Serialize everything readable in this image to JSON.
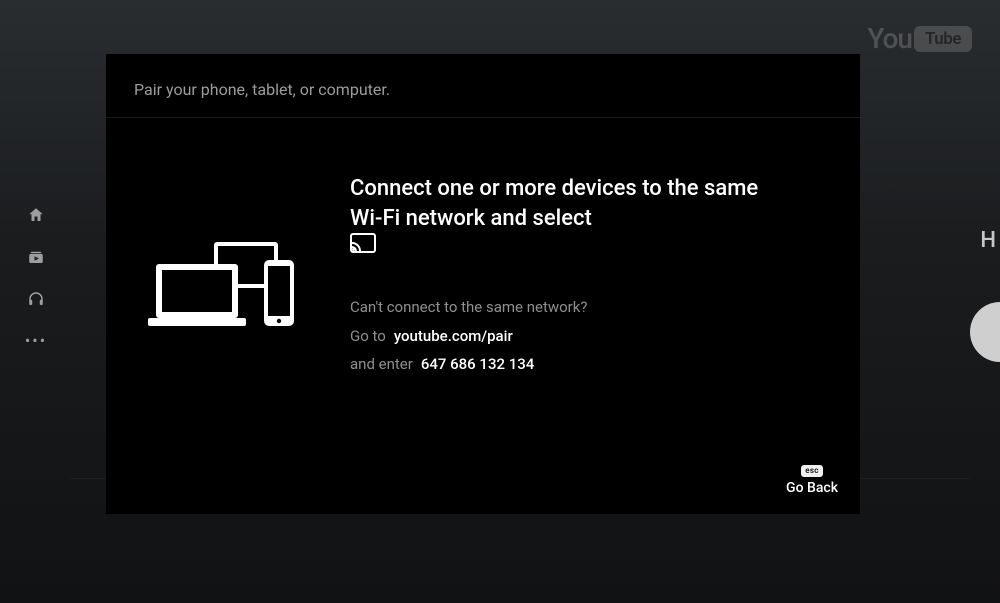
{
  "brand": {
    "part1": "You",
    "part2": "Tube"
  },
  "sidebar": {
    "home_icon": "home-icon",
    "subs_icon": "subscriptions-icon",
    "music_icon": "headphones-icon",
    "more_icon": "more-icon"
  },
  "modal": {
    "title": "Pair your phone, tablet, or computer.",
    "headline": "Connect one or more devices to the same Wi-Fi network and select",
    "cast_icon": "cast-icon",
    "alt_question": "Can't connect to the same network?",
    "goto_prefix": "Go to",
    "goto_url": "youtube.com/pair",
    "enter_prefix": "and enter",
    "pair_code": "647 686 132 134",
    "back": {
      "key": "esc",
      "label": "Go Back"
    }
  },
  "right_edge_letter": "H"
}
